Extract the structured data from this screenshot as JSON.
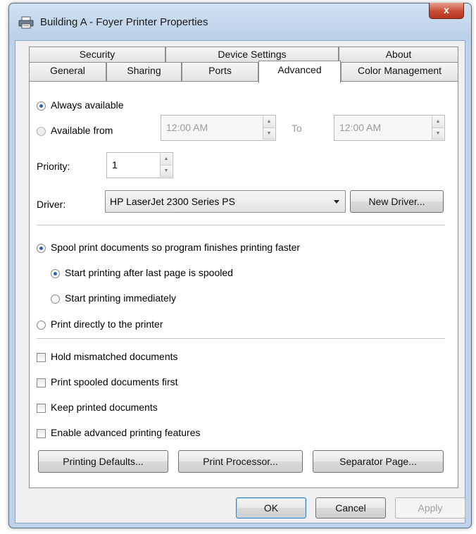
{
  "window": {
    "title": "Building A - Foyer Printer Properties",
    "close_label": "x"
  },
  "tabs": {
    "row1": [
      "Security",
      "Device Settings",
      "About"
    ],
    "row2": [
      "General",
      "Sharing",
      "Ports",
      "Advanced",
      "Color Management"
    ],
    "active": "Advanced"
  },
  "availability": {
    "always": "Always available",
    "from": "Available from",
    "from_time": "12:00 AM",
    "to_label": "To",
    "to_time": "12:00 AM",
    "selected": "always"
  },
  "priority": {
    "label": "Priority:",
    "value": "1"
  },
  "driver": {
    "label": "Driver:",
    "value": "HP LaserJet 2300 Series PS",
    "new_button": "New Driver..."
  },
  "spool": {
    "spool_option": "Spool print documents so program finishes printing faster",
    "after_last_page": "Start printing after last page is spooled",
    "immediately": "Start printing immediately",
    "direct": "Print directly to the printer"
  },
  "checkboxes": [
    {
      "label": "Hold mismatched documents",
      "checked": false
    },
    {
      "label": "Print spooled documents first",
      "checked": false
    },
    {
      "label": "Keep printed documents",
      "checked": false
    },
    {
      "label": "Enable advanced printing features",
      "checked": false
    }
  ],
  "panel_buttons": {
    "printing_defaults": "Printing Defaults...",
    "print_processor": "Print Processor...",
    "separator_page": "Separator Page..."
  },
  "dialog_buttons": {
    "ok": "OK",
    "cancel": "Cancel",
    "apply": "Apply"
  }
}
